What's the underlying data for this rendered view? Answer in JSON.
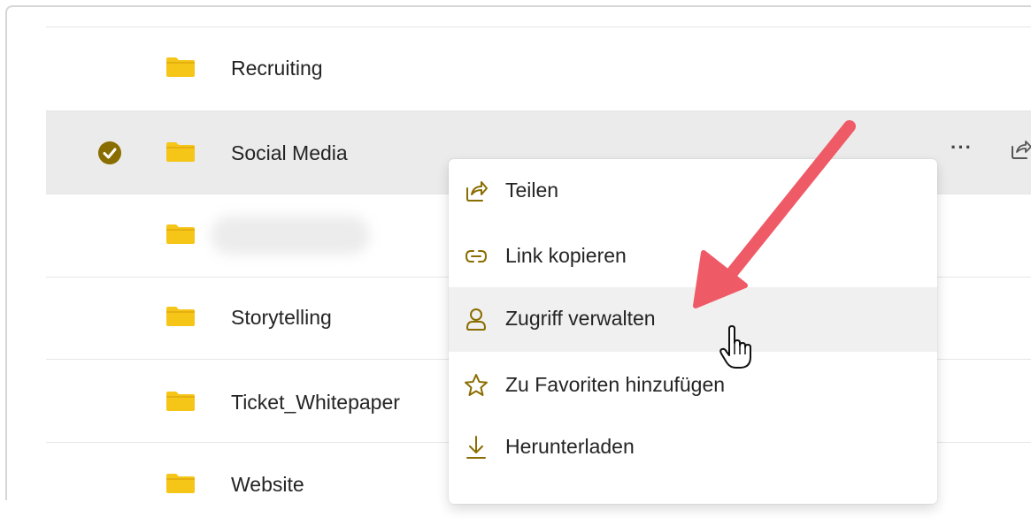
{
  "files": [
    {
      "name": "Recruiting",
      "selected": false
    },
    {
      "name": "Social Media",
      "selected": true
    },
    {
      "name": "",
      "selected": false,
      "blurred": true
    },
    {
      "name": "Storytelling",
      "selected": false
    },
    {
      "name": "Ticket_Whitepaper",
      "selected": false
    },
    {
      "name": "Website",
      "selected": false
    }
  ],
  "row_actions": {
    "more": "···"
  },
  "context_menu": {
    "items": [
      {
        "label": "Teilen",
        "icon": "share-icon"
      },
      {
        "label": "Link kopieren",
        "icon": "link-icon"
      },
      {
        "label": "Zugriff verwalten",
        "icon": "person-icon",
        "highlighted": true
      },
      {
        "label": "Zu Favoriten hinzufügen",
        "icon": "star-icon"
      },
      {
        "label": "Herunterladen",
        "icon": "download-icon"
      }
    ]
  },
  "colors": {
    "folder": "#f5c518",
    "folder_dark": "#e2a90d",
    "check": "#8a6d00",
    "arrow": "#ef5a67",
    "selected_row": "#ebebeb",
    "menu_hover": "#f0f0f0",
    "accent_icon": "#8a6d00"
  }
}
